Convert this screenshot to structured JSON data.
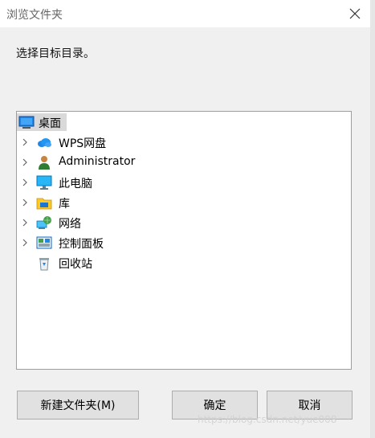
{
  "window": {
    "title": "浏览文件夹"
  },
  "instruction": "选择目标目录。",
  "tree": {
    "root": {
      "label": "桌面",
      "icon": "desktop-icon"
    },
    "items": [
      {
        "label": "WPS网盘",
        "icon": "cloud-icon",
        "expandable": true
      },
      {
        "label": "Administrator",
        "icon": "user-icon",
        "expandable": true
      },
      {
        "label": "此电脑",
        "icon": "computer-icon",
        "expandable": true
      },
      {
        "label": "库",
        "icon": "library-icon",
        "expandable": true
      },
      {
        "label": "网络",
        "icon": "network-icon",
        "expandable": true
      },
      {
        "label": "控制面板",
        "icon": "control-panel-icon",
        "expandable": true
      },
      {
        "label": "回收站",
        "icon": "recycle-bin-icon",
        "expandable": false
      }
    ]
  },
  "buttons": {
    "new_folder": "新建文件夹(M)",
    "ok": "确定",
    "cancel": "取消"
  },
  "watermark": "https://blog.csdn.net/yue008",
  "colors": {
    "titlebar": "#ffffff",
    "dialog_bg": "#f0f0f0",
    "selection": "#d9d9d9",
    "button_bg": "#e1e1e1",
    "button_border": "#adadad"
  }
}
